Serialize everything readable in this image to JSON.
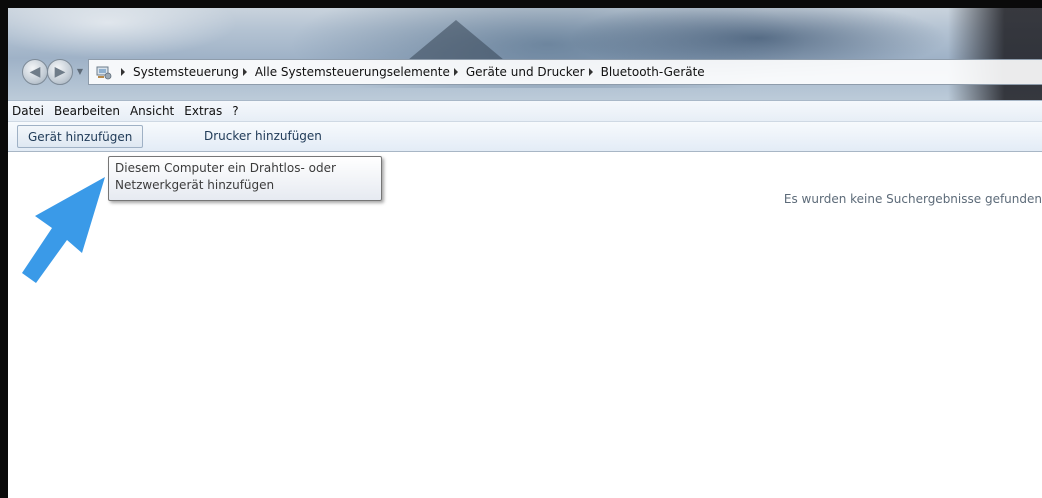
{
  "window": {
    "breadcrumb": [
      "Systemsteuerung",
      "Alle Systemsteuerungselemente",
      "Geräte und Drucker",
      "Bluetooth-Geräte"
    ]
  },
  "menu": {
    "items": [
      "Datei",
      "Bearbeiten",
      "Ansicht",
      "Extras",
      "?"
    ]
  },
  "toolbar": {
    "add_device_label": "Gerät hinzufügen",
    "add_printer_label": "Drucker hinzufügen"
  },
  "tooltip": {
    "line1": "Diesem Computer ein Drahtlos- oder",
    "line2": "Netzwerkgerät hinzufügen"
  },
  "content": {
    "empty_message": "Es wurden keine Suchergebnisse gefunden"
  },
  "overlay": {
    "arrow_color": "#3a9ae8"
  }
}
